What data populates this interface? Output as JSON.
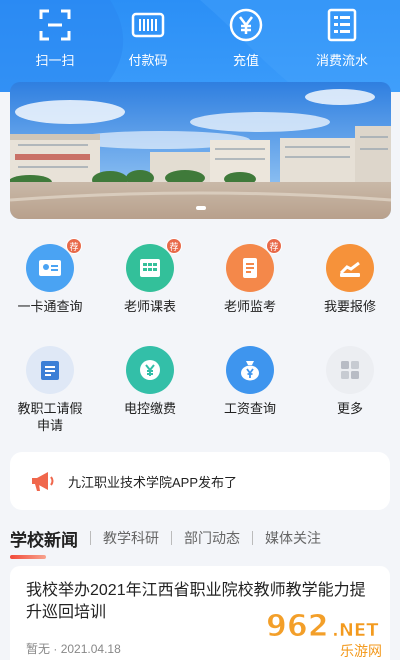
{
  "colors": {
    "header_blue": "#2b8ff6",
    "accent_red": "#f24a3a"
  },
  "quick_actions": [
    {
      "label": "扫一扫",
      "icon": "scan-icon"
    },
    {
      "label": "付款码",
      "icon": "barcode-icon"
    },
    {
      "label": "充值",
      "icon": "yuan-coin-icon"
    },
    {
      "label": "消费流水",
      "icon": "ledger-icon"
    }
  ],
  "services": [
    {
      "label": "一卡通查询",
      "icon": "id-card-icon",
      "badge": "荐",
      "color": "#4aa3f3"
    },
    {
      "label": "老师课表",
      "icon": "timetable-icon",
      "badge": "荐",
      "color": "#33c09a"
    },
    {
      "label": "老师监考",
      "icon": "exam-icon",
      "badge": "荐",
      "color": "#f4884a"
    },
    {
      "label": "我要报修",
      "icon": "repair-icon",
      "badge": "",
      "color": "#f6923a"
    },
    {
      "label": "教职工请假申请",
      "icon": "leave-form-icon",
      "badge": "",
      "color": "#4a9bf0"
    },
    {
      "label": "电控缴费",
      "icon": "electric-fee-icon",
      "badge": "",
      "color": "#33bfa8"
    },
    {
      "label": "工资查询",
      "icon": "salary-bag-icon",
      "badge": "",
      "color": "#3e95ee"
    },
    {
      "label": "更多",
      "icon": "more-grid-icon",
      "badge": "",
      "color": "#c9cdd6"
    }
  ],
  "notice": {
    "text": "九江职业技术学院APP发布了",
    "icon": "megaphone-icon"
  },
  "news_tabs": {
    "active": "学校新闻",
    "others": [
      "教学科研",
      "部门动态",
      "媒体关注"
    ]
  },
  "news": {
    "title": "我校举办2021年江西省职业院校教师教学能力提升巡回培训",
    "author": "暂无",
    "date": "2021.04.18"
  },
  "watermark": {
    "text": "962.NET",
    "sub": "乐游网"
  }
}
